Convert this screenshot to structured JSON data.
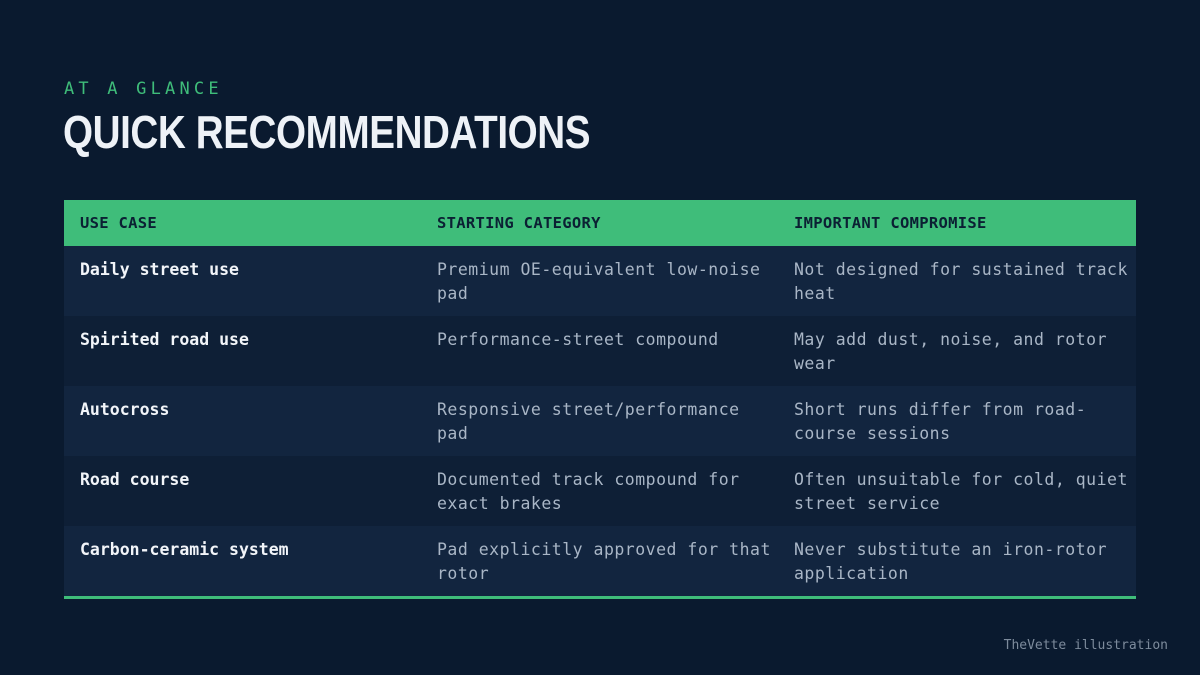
{
  "header": {
    "eyebrow": "AT A GLANCE",
    "title": "QUICK RECOMMENDATIONS"
  },
  "table": {
    "columns": [
      "USE CASE",
      "STARTING CATEGORY",
      "IMPORTANT COMPROMISE"
    ],
    "rows": [
      {
        "use_case": "Daily street use",
        "category": "Premium OE-equivalent low-noise pad",
        "compromise": "Not designed for sustained track heat"
      },
      {
        "use_case": "Spirited road use",
        "category": "Performance-street compound",
        "compromise": "May add dust, noise, and rotor wear"
      },
      {
        "use_case": "Autocross",
        "category": "Responsive street/performance pad",
        "compromise": "Short runs differ from road-course sessions"
      },
      {
        "use_case": "Road course",
        "category": "Documented track compound for exact brakes",
        "compromise": "Often unsuitable for cold, quiet street service"
      },
      {
        "use_case": "Carbon-ceramic system",
        "category": "Pad explicitly approved for that rotor",
        "compromise": "Never substitute an iron-rotor application"
      }
    ]
  },
  "footer": {
    "credit": "TheVette illustration"
  },
  "colors": {
    "background": "#0a1a2f",
    "accent": "#3fbd7a",
    "row_odd": "#12253f",
    "row_even": "#0e1f36"
  }
}
